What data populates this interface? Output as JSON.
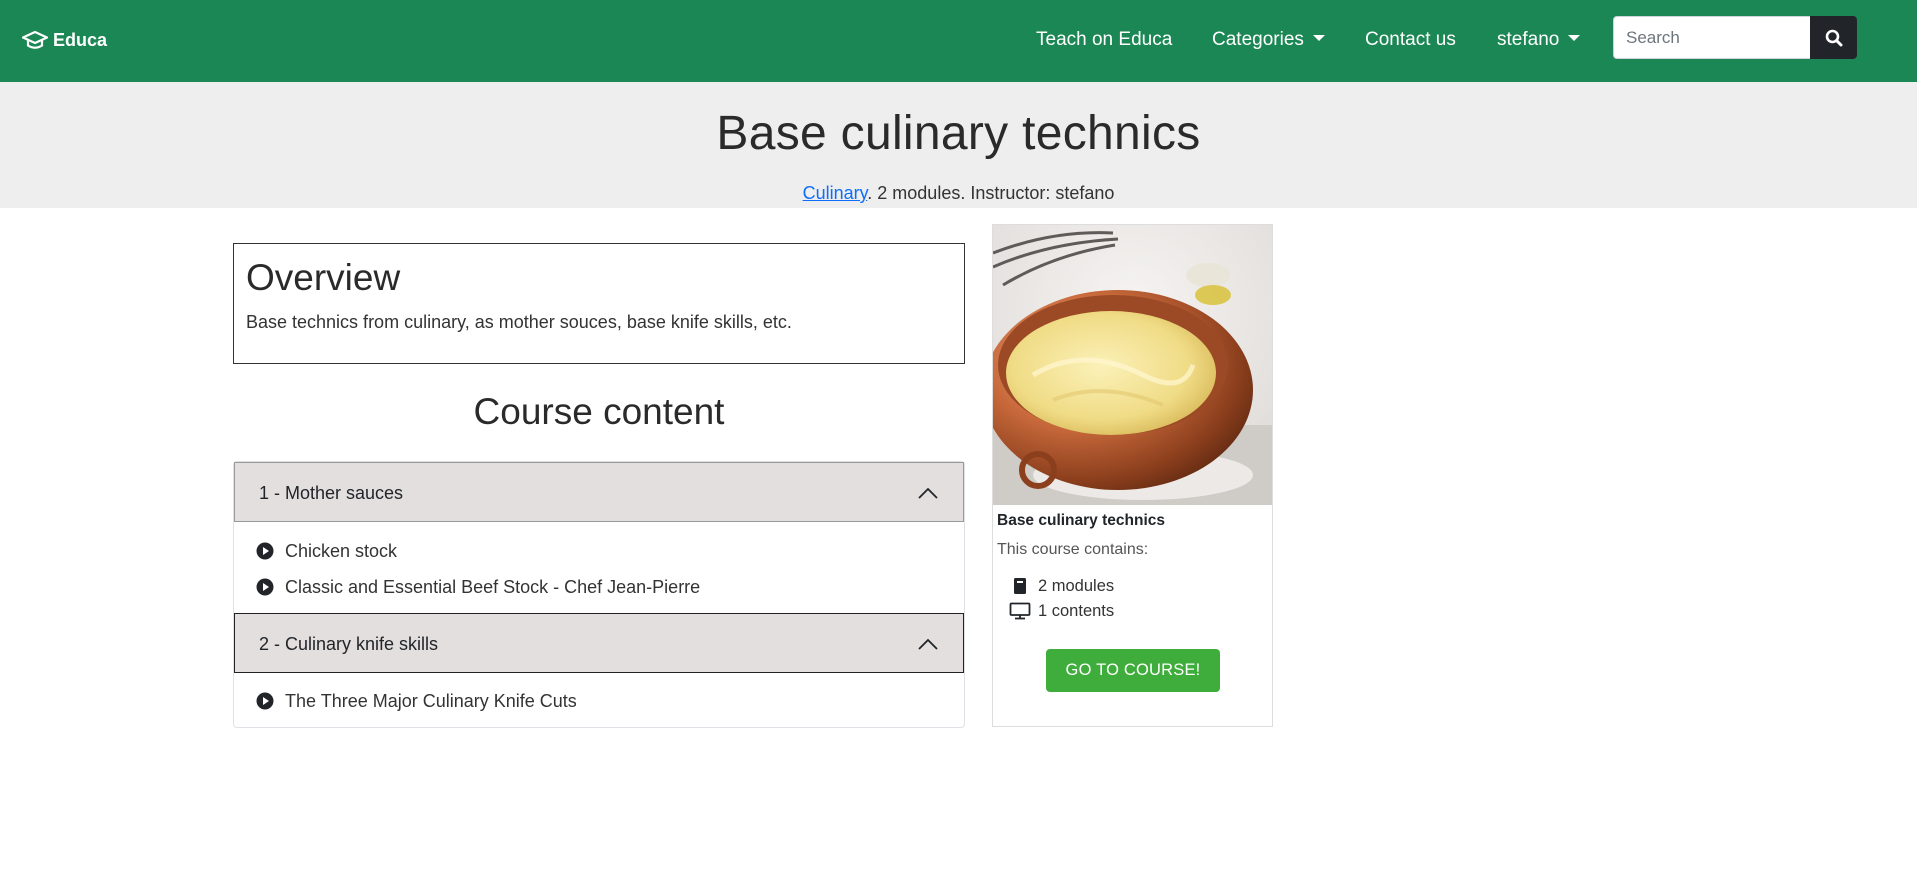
{
  "navbar": {
    "brand": "Educa",
    "links": {
      "teach": "Teach on Educa",
      "categories": "Categories",
      "contact": "Contact us",
      "user": "stefano"
    },
    "search": {
      "placeholder": "Search",
      "value": ""
    },
    "colors": {
      "background": "#1b8754"
    }
  },
  "header": {
    "title": "Base culinary technics",
    "category_link": "Culinary",
    "meta": ". 2 modules. Instructor: stefano"
  },
  "overview": {
    "heading": "Overview",
    "description": "Base technics from culinary, as mother souces, base knife skills, etc."
  },
  "content": {
    "heading": "Course content",
    "modules": [
      {
        "title": "1 - Mother sauces",
        "items": [
          "Chicken stock",
          "Classic and Essential Beef Stock - Chef Jean-Pierre"
        ]
      },
      {
        "title": "2 - Culinary knife skills",
        "items": [
          "The Three Major Culinary Knife Cuts"
        ]
      }
    ]
  },
  "card": {
    "title": "Base culinary technics",
    "text": "This course contains:",
    "modules_stat": "2 modules",
    "contents_stat": "1 contents",
    "button": "GO TO COURSE!",
    "colors": {
      "button": "#3fad3b"
    }
  },
  "icons": {
    "brand": "graduation-cap-icon",
    "search": "search-icon",
    "item": "play-circle-icon",
    "chevron": "chevron-up-icon",
    "modules": "book-icon",
    "contents": "monitor-icon"
  }
}
